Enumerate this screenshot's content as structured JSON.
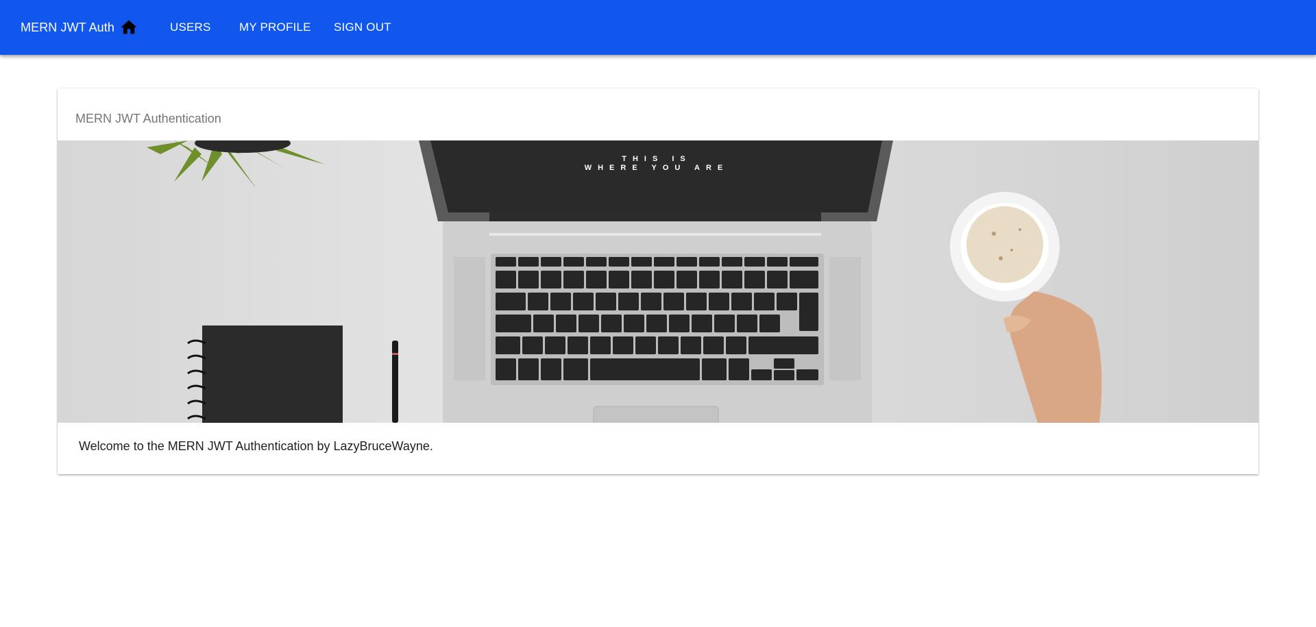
{
  "header": {
    "brand": "MERN JWT Auth",
    "home_icon": "home-icon",
    "nav": [
      {
        "label": "USERS"
      },
      {
        "label": "MY PROFILE"
      },
      {
        "label": "SIGN OUT"
      }
    ],
    "bar_color": "#1157ed"
  },
  "card": {
    "title": "MERN JWT Authentication",
    "image": {
      "screen_text_line1": "THIS IS",
      "screen_text_line2": "WHERE YOU ARE"
    },
    "body": "Welcome to the MERN JWT Authentication by LazyBruceWayne."
  }
}
